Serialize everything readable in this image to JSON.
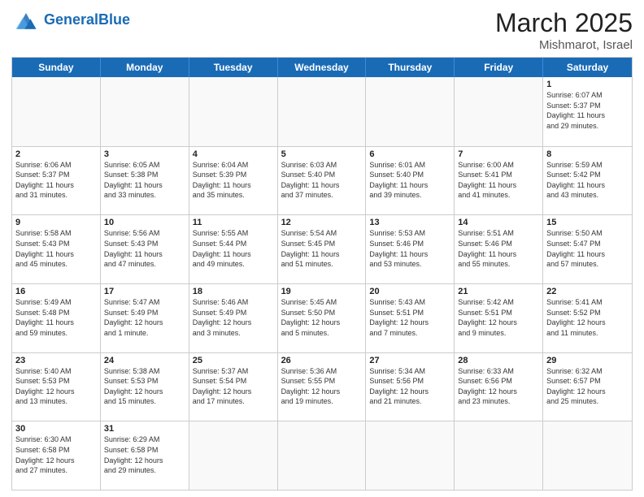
{
  "header": {
    "logo_general": "General",
    "logo_blue": "Blue",
    "month_title": "March 2025",
    "subtitle": "Mishmarot, Israel"
  },
  "day_headers": [
    "Sunday",
    "Monday",
    "Tuesday",
    "Wednesday",
    "Thursday",
    "Friday",
    "Saturday"
  ],
  "weeks": [
    [
      {
        "num": "",
        "info": ""
      },
      {
        "num": "",
        "info": ""
      },
      {
        "num": "",
        "info": ""
      },
      {
        "num": "",
        "info": ""
      },
      {
        "num": "",
        "info": ""
      },
      {
        "num": "",
        "info": ""
      },
      {
        "num": "1",
        "info": "Sunrise: 6:07 AM\nSunset: 5:37 PM\nDaylight: 11 hours\nand 29 minutes."
      }
    ],
    [
      {
        "num": "2",
        "info": "Sunrise: 6:06 AM\nSunset: 5:37 PM\nDaylight: 11 hours\nand 31 minutes."
      },
      {
        "num": "3",
        "info": "Sunrise: 6:05 AM\nSunset: 5:38 PM\nDaylight: 11 hours\nand 33 minutes."
      },
      {
        "num": "4",
        "info": "Sunrise: 6:04 AM\nSunset: 5:39 PM\nDaylight: 11 hours\nand 35 minutes."
      },
      {
        "num": "5",
        "info": "Sunrise: 6:03 AM\nSunset: 5:40 PM\nDaylight: 11 hours\nand 37 minutes."
      },
      {
        "num": "6",
        "info": "Sunrise: 6:01 AM\nSunset: 5:40 PM\nDaylight: 11 hours\nand 39 minutes."
      },
      {
        "num": "7",
        "info": "Sunrise: 6:00 AM\nSunset: 5:41 PM\nDaylight: 11 hours\nand 41 minutes."
      },
      {
        "num": "8",
        "info": "Sunrise: 5:59 AM\nSunset: 5:42 PM\nDaylight: 11 hours\nand 43 minutes."
      }
    ],
    [
      {
        "num": "9",
        "info": "Sunrise: 5:58 AM\nSunset: 5:43 PM\nDaylight: 11 hours\nand 45 minutes."
      },
      {
        "num": "10",
        "info": "Sunrise: 5:56 AM\nSunset: 5:43 PM\nDaylight: 11 hours\nand 47 minutes."
      },
      {
        "num": "11",
        "info": "Sunrise: 5:55 AM\nSunset: 5:44 PM\nDaylight: 11 hours\nand 49 minutes."
      },
      {
        "num": "12",
        "info": "Sunrise: 5:54 AM\nSunset: 5:45 PM\nDaylight: 11 hours\nand 51 minutes."
      },
      {
        "num": "13",
        "info": "Sunrise: 5:53 AM\nSunset: 5:46 PM\nDaylight: 11 hours\nand 53 minutes."
      },
      {
        "num": "14",
        "info": "Sunrise: 5:51 AM\nSunset: 5:46 PM\nDaylight: 11 hours\nand 55 minutes."
      },
      {
        "num": "15",
        "info": "Sunrise: 5:50 AM\nSunset: 5:47 PM\nDaylight: 11 hours\nand 57 minutes."
      }
    ],
    [
      {
        "num": "16",
        "info": "Sunrise: 5:49 AM\nSunset: 5:48 PM\nDaylight: 11 hours\nand 59 minutes."
      },
      {
        "num": "17",
        "info": "Sunrise: 5:47 AM\nSunset: 5:49 PM\nDaylight: 12 hours\nand 1 minute."
      },
      {
        "num": "18",
        "info": "Sunrise: 5:46 AM\nSunset: 5:49 PM\nDaylight: 12 hours\nand 3 minutes."
      },
      {
        "num": "19",
        "info": "Sunrise: 5:45 AM\nSunset: 5:50 PM\nDaylight: 12 hours\nand 5 minutes."
      },
      {
        "num": "20",
        "info": "Sunrise: 5:43 AM\nSunset: 5:51 PM\nDaylight: 12 hours\nand 7 minutes."
      },
      {
        "num": "21",
        "info": "Sunrise: 5:42 AM\nSunset: 5:51 PM\nDaylight: 12 hours\nand 9 minutes."
      },
      {
        "num": "22",
        "info": "Sunrise: 5:41 AM\nSunset: 5:52 PM\nDaylight: 12 hours\nand 11 minutes."
      }
    ],
    [
      {
        "num": "23",
        "info": "Sunrise: 5:40 AM\nSunset: 5:53 PM\nDaylight: 12 hours\nand 13 minutes."
      },
      {
        "num": "24",
        "info": "Sunrise: 5:38 AM\nSunset: 5:53 PM\nDaylight: 12 hours\nand 15 minutes."
      },
      {
        "num": "25",
        "info": "Sunrise: 5:37 AM\nSunset: 5:54 PM\nDaylight: 12 hours\nand 17 minutes."
      },
      {
        "num": "26",
        "info": "Sunrise: 5:36 AM\nSunset: 5:55 PM\nDaylight: 12 hours\nand 19 minutes."
      },
      {
        "num": "27",
        "info": "Sunrise: 5:34 AM\nSunset: 5:56 PM\nDaylight: 12 hours\nand 21 minutes."
      },
      {
        "num": "28",
        "info": "Sunrise: 6:33 AM\nSunset: 6:56 PM\nDaylight: 12 hours\nand 23 minutes."
      },
      {
        "num": "29",
        "info": "Sunrise: 6:32 AM\nSunset: 6:57 PM\nDaylight: 12 hours\nand 25 minutes."
      }
    ],
    [
      {
        "num": "30",
        "info": "Sunrise: 6:30 AM\nSunset: 6:58 PM\nDaylight: 12 hours\nand 27 minutes."
      },
      {
        "num": "31",
        "info": "Sunrise: 6:29 AM\nSunset: 6:58 PM\nDaylight: 12 hours\nand 29 minutes."
      },
      {
        "num": "",
        "info": ""
      },
      {
        "num": "",
        "info": ""
      },
      {
        "num": "",
        "info": ""
      },
      {
        "num": "",
        "info": ""
      },
      {
        "num": "",
        "info": ""
      }
    ]
  ]
}
